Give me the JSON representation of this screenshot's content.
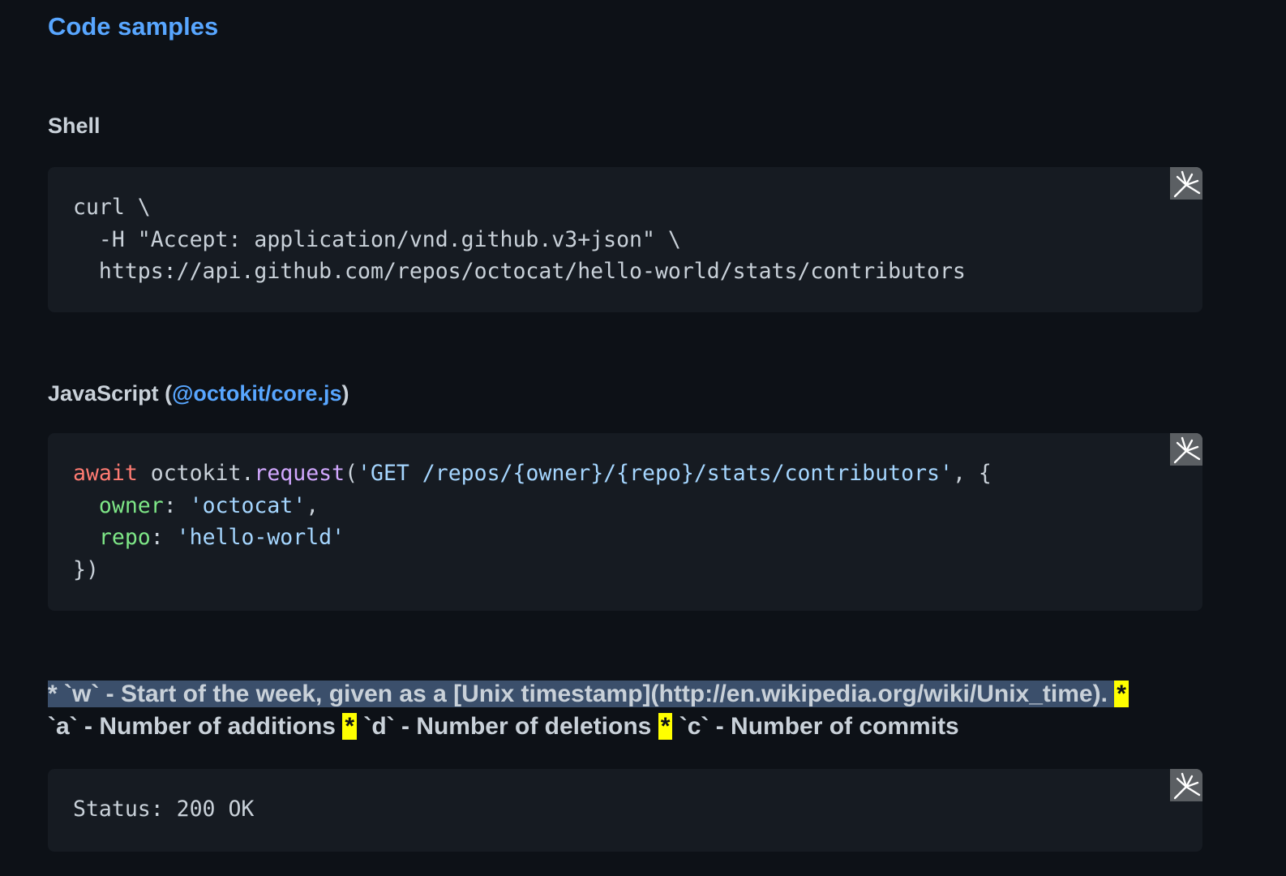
{
  "section_title": "Code samples",
  "shell": {
    "heading": "Shell",
    "lines": [
      "curl \\",
      "  -H \"Accept: application/vnd.github.v3+json\" \\",
      "  https://api.github.com/repos/octocat/hello-world/stats/contributors"
    ]
  },
  "javascript": {
    "heading_prefix": "JavaScript (",
    "heading_link": "@octokit/core.js",
    "heading_suffix": ")",
    "tokens": {
      "await": "await",
      "octokit": " octokit.",
      "request": "request",
      "paren_open": "(",
      "url": "'GET /repos/{owner}/{repo}/stats/contributors'",
      "after_url": ", {",
      "owner_key": "owner",
      "owner_sep": ": ",
      "owner_val": "'octocat'",
      "owner_comma": ",",
      "repo_key": "repo",
      "repo_sep": ": ",
      "repo_val": "'hello-world'",
      "close": "})"
    }
  },
  "description": {
    "star": "*",
    "w_text": " `w` - Start of the week, given as a [Unix timestamp](http://en.wikipedia.org/wiki/Unix_time). ",
    "a_text": "`a` - Number of additions ",
    "d_text": " `d` - Number of deletions ",
    "c_text": " `c` - Number of commits"
  },
  "response": {
    "status_line": "Status: 200 OK"
  },
  "icons": {
    "copy": "copy-icon"
  },
  "colors": {
    "background": "#0d1117",
    "code_bg": "#161b22",
    "link": "#58a6ff",
    "keyword": "#ff7b72",
    "function": "#d2a8ff",
    "string": "#a5d6ff",
    "property": "#7ee787",
    "highlight": "#ffff00",
    "selection": "#3b4f6b"
  }
}
